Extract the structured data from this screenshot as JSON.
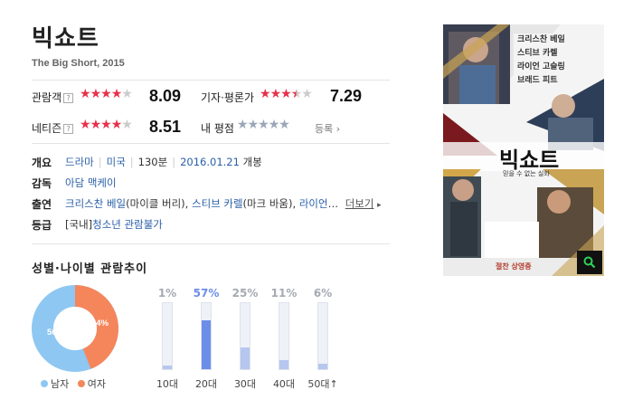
{
  "movie": {
    "title": "빅쇼트",
    "subtitle": "The Big Short, 2015"
  },
  "ratings": {
    "audience": {
      "label": "관람객",
      "help": "?",
      "score": "8.09",
      "stars": 4.0
    },
    "critic": {
      "label": "기자·평론가",
      "score": "7.29",
      "stars": 3.5
    },
    "netizen": {
      "label": "네티즌",
      "help": "?",
      "score": "8.51",
      "stars": 4.0
    },
    "mine": {
      "label": "내 평점",
      "stars": 0,
      "register": "등록",
      "register_arrow": "›"
    }
  },
  "info": {
    "overview_label": "개요",
    "genre": "드라마",
    "country": "미국",
    "runtime": "130분",
    "release_date": "2016.01.21",
    "release_suffix": "개봉",
    "director_label": "감독",
    "director": "아담 맥케이",
    "cast_label": "출연",
    "cast1_name": "크리스찬 베일",
    "cast1_role": "(마이클 버리),",
    "cast2_name": "스티브 카렐",
    "cast2_role": "(마크 바움),",
    "cast3_name": "라이언",
    "cast_ellipsis": "…",
    "more": "더보기",
    "more_arrow": "▸",
    "grade_label": "등급",
    "grade_prefix": "[국내]",
    "grade": "청소년 관람불가"
  },
  "poster": {
    "credits": [
      "크리스찬 베일",
      "스티브 카렐",
      "라이언 고슬링",
      "브래드 피트"
    ],
    "title": "빅쇼트",
    "tagline": "믿을 수 없는 실화",
    "release": "절찬 상영중",
    "zoom_icon": "magnifier-icon"
  },
  "stats": {
    "title": "성별·나이별 관람추이",
    "gender": [
      {
        "label": "남자",
        "percent": 56,
        "color": "#8ec7f2"
      },
      {
        "label": "여자",
        "percent": 44,
        "color": "#f5865c"
      }
    ],
    "male_pct_label": "56%",
    "female_pct_label": "44%",
    "ages": [
      {
        "label": "10대",
        "pct_label": "1%",
        "value": 1
      },
      {
        "label": "20대",
        "pct_label": "57%",
        "value": 57
      },
      {
        "label": "30대",
        "pct_label": "25%",
        "value": 25
      },
      {
        "label": "40대",
        "pct_label": "11%",
        "value": 11
      },
      {
        "label": "50대↑",
        "pct_label": "6%",
        "value": 6
      }
    ]
  },
  "colors": {
    "star_on": "#e8304a",
    "star_off": "#ccc",
    "star_mine": "#9aa7b8",
    "bar_highlight": "#6d8ee8",
    "bar_normal": "#b6c6ef",
    "pct_highlight": "#6d8ee8",
    "pct_normal": "#a5a9b1"
  }
}
